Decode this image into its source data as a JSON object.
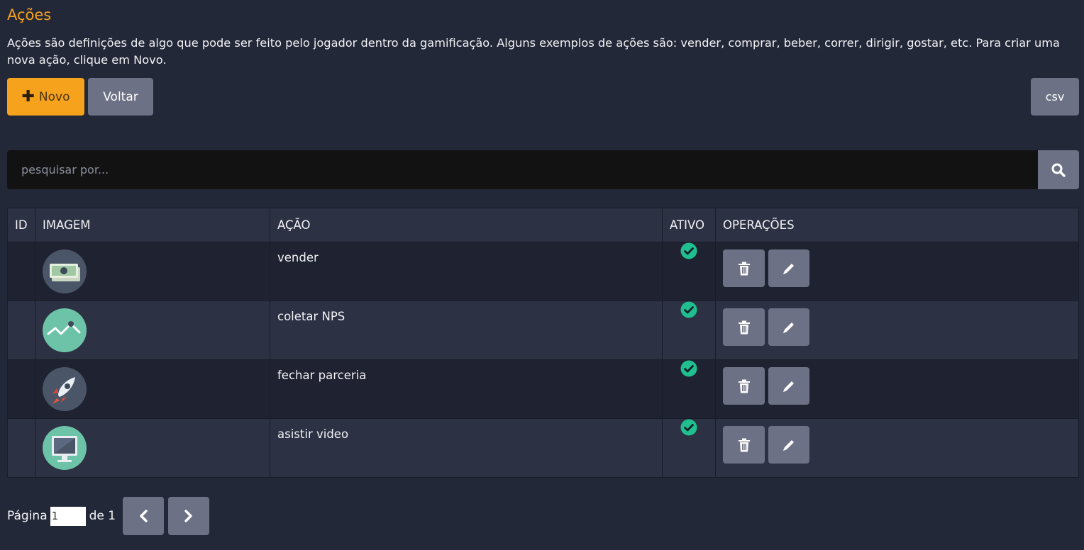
{
  "page": {
    "title": "Ações",
    "description": "Ações são definições de algo que pode ser feito pelo jogador dentro da gamificação. Alguns exemplos de ações são: vender, comprar, beber, correr, dirigir, gostar, etc. Para criar uma nova ação, clique em Novo."
  },
  "toolbar": {
    "new_label": "Novo",
    "back_label": "Voltar",
    "csv_label": "csv"
  },
  "search": {
    "placeholder": "pesquisar por..."
  },
  "table": {
    "headers": {
      "id": "ID",
      "image": "IMAGEM",
      "action": "AÇÃO",
      "active": "ATIVO",
      "operations": "OPERAÇÕES"
    },
    "rows": [
      {
        "id": "",
        "image_icon": "money-icon",
        "action": "vender",
        "active": true,
        "avatar_color": "#4b5568"
      },
      {
        "id": "",
        "image_icon": "chart-line-icon",
        "action": "coletar NPS",
        "active": true,
        "avatar_color": "#6cc3a7"
      },
      {
        "id": "",
        "image_icon": "rocket-icon",
        "action": "fechar parceria",
        "active": true,
        "avatar_color": "#4b5568"
      },
      {
        "id": "",
        "image_icon": "monitor-icon",
        "action": "asistir video",
        "active": true,
        "avatar_color": "#6cc3a7"
      }
    ]
  },
  "pagination": {
    "page_label": "Página",
    "current_page": "1",
    "of_label": "de 1"
  },
  "colors": {
    "accent": "#f6a21d",
    "button_gray": "#6d7185",
    "active_check": "#1fbf8f",
    "background": "#232838"
  }
}
